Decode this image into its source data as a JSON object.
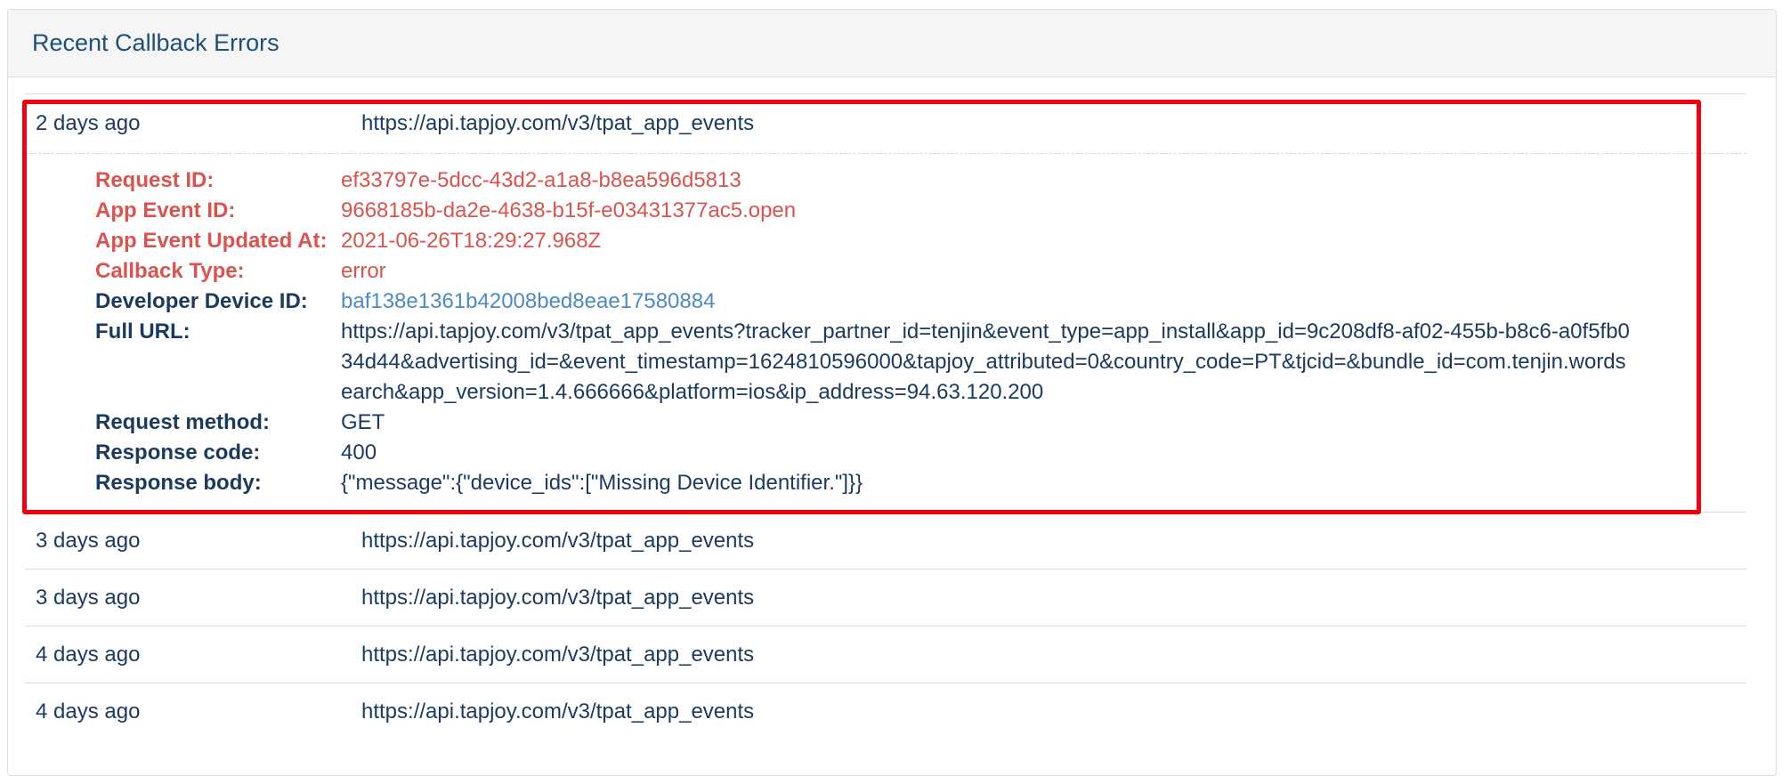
{
  "panel": {
    "title": "Recent Callback Errors"
  },
  "expanded_row": {
    "age": "2 days ago",
    "url": "https://api.tapjoy.com/v3/tpat_app_events",
    "details": [
      {
        "label": "Request ID:",
        "value": "ef33797e-5dcc-43d2-a1a8-b8ea596d5813",
        "style": "error"
      },
      {
        "label": "App Event ID:",
        "value": "9668185b-da2e-4638-b15f-e03431377ac5.open",
        "style": "error"
      },
      {
        "label": "App Event Updated At:",
        "value": "2021-06-26T18:29:27.968Z",
        "style": "error"
      },
      {
        "label": "Callback Type:",
        "value": "error",
        "style": "error"
      },
      {
        "label": "Developer Device ID:",
        "value": "baf138e1361b42008bed8eae17580884",
        "style": "link"
      },
      {
        "label": "Full URL:",
        "value": "https://api.tapjoy.com/v3/tpat_app_events?tracker_partner_id=tenjin&event_type=app_install&app_id=9c208df8-af02-455b-b8c6-a0f5fb034d44&advertising_id=&event_timestamp=1624810596000&tapjoy_attributed=0&country_code=PT&tjcid=&bundle_id=com.tenjin.wordsearch&app_version=1.4.666666&platform=ios&ip_address=94.63.120.200",
        "style": "normal"
      },
      {
        "label": "Request method:",
        "value": "GET",
        "style": "normal"
      },
      {
        "label": "Response code:",
        "value": "400",
        "style": "normal"
      },
      {
        "label": "Response body:",
        "value": "{\"message\":{\"device_ids\":[\"Missing Device Identifier.\"]}}",
        "style": "normal"
      }
    ]
  },
  "rows": [
    {
      "age": "3 days ago",
      "url": "https://api.tapjoy.com/v3/tpat_app_events"
    },
    {
      "age": "3 days ago",
      "url": "https://api.tapjoy.com/v3/tpat_app_events"
    },
    {
      "age": "4 days ago",
      "url": "https://api.tapjoy.com/v3/tpat_app_events"
    },
    {
      "age": "4 days ago",
      "url": "https://api.tapjoy.com/v3/tpat_app_events"
    }
  ],
  "colors": {
    "heading_text": "#1f4e79",
    "error_text": "#d9534f",
    "link_text": "#4a8ac7",
    "highlight_border": "#f0000f"
  }
}
